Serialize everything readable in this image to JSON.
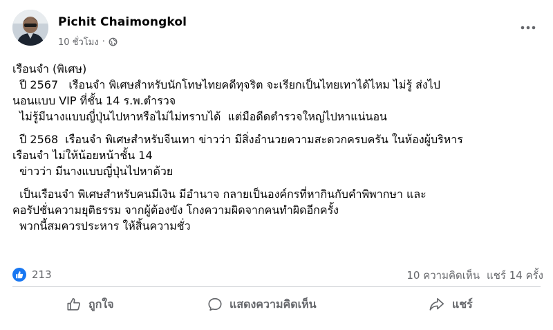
{
  "post": {
    "author": "Pichit Chaimongkol",
    "time": "10 ชั่วโมง",
    "separator": "·",
    "privacy_icon": "globe-icon",
    "more_icon": "more-dots-icon",
    "lines": [
      "เรือนจำ (พิเศษ)",
      "  ปี 2567   เรือนจำ พิเศษสำหรับนักโทษไทยคดีทุจริต จะเรียกเป็นไทยเทาได้ไหม ไม่รู้ ส่งไป",
      "นอนแบบ VIP ที่ชั้น 14 ร.พ.ตำรวจ",
      "  ไม่รู้มีนางแบบญี่ปุ่นไปหาหรือไม่ไม่ทราบได้  แต่มือดีดตำรวจใหญ่ไปหาแน่นอน",
      "  ปี 2568  เรือนจำ พิเศษสำหรับจีนเทา ข่าวว่า มีสิ่งอำนวยความสะดวกครบครัน ในห้องผู้บริหาร",
      "เรือนจำ ไม่ให้น้อยหน้าชั้น 14",
      "  ข่าวว่า มีนางแบบญี่ปุ่นไปหาด้วย",
      "  เป็นเรือนจำ พิเศษสำหรับคนมีเงิน มีอำนาจ กลายเป็นองค์กรที่หากินกับคำพิพากษา และ",
      "คอรัปชั่นความยุติธรรม จากผู้ต้องขัง โกงความผิดจากคนทำผิดอีกครั้ง",
      "  พวกนี้สมควรประหาร ให้สิ้นความชั่ว"
    ]
  },
  "engagement": {
    "reaction_icon": "like-icon",
    "reaction_count": "213",
    "comments": "10 ความคิดเห็น",
    "shares": "แชร์ 14 ครั้ง"
  },
  "actions": {
    "like": "ถูกใจ",
    "comment": "แสดงความคิดเห็น",
    "share": "แชร์"
  },
  "colors": {
    "accent": "#1877f2",
    "secondary_text": "#65676b",
    "divider": "#ced0d4"
  }
}
